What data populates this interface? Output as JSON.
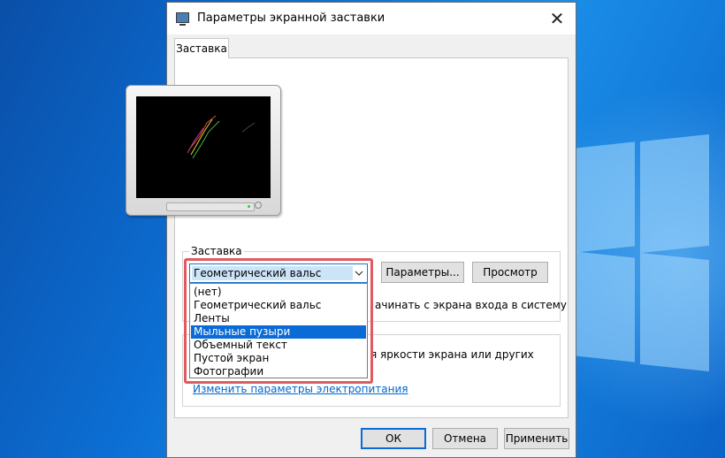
{
  "dialog": {
    "title": "Параметры экранной заставки",
    "close_glyph": "✕"
  },
  "tabs": [
    {
      "label": "Заставка"
    }
  ],
  "screensaver": {
    "group_label": "Заставка",
    "selected": "Геометрический вальс",
    "options": [
      "(нет)",
      "Геометрический вальс",
      "Ленты",
      "Мыльные пузыри",
      "Объемный текст",
      "Пустой экран",
      "Фотографии"
    ],
    "highlighted_option": "Мыльные пузыри",
    "settings_button": "Параметры...",
    "preview_button": "Просмотр",
    "logon_text_partial": "ачинать с экрана входа в систему"
  },
  "power": {
    "text_partial": "я яркости экрана или других",
    "link": "Изменить параметры электропитания"
  },
  "footer": {
    "ok": "ОК",
    "cancel": "Отмена",
    "apply": "Применить"
  },
  "colors": {
    "accent": "#0a6bd6",
    "highlight_frame": "#e05a5f",
    "desktop": "#0c6fd4"
  }
}
